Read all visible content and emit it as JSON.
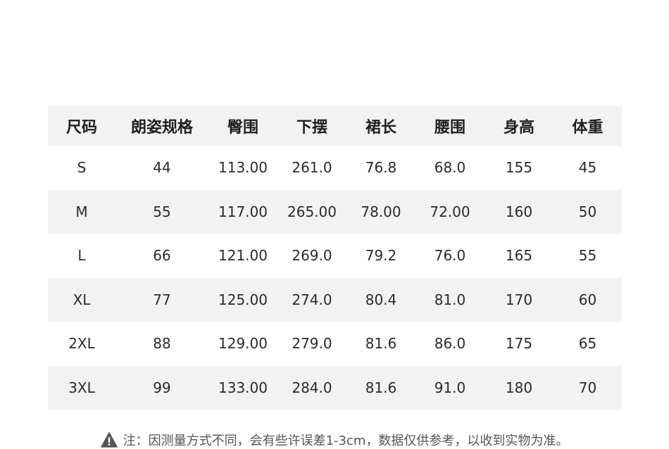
{
  "table": {
    "headers": [
      "尺码",
      "朗姿规格",
      "臀围",
      "下摆",
      "裙长",
      "腰围",
      "身高",
      "体重"
    ],
    "rows": [
      [
        "S",
        "44",
        "113.00",
        "261.0",
        "76.8",
        "68.0",
        "155",
        "45"
      ],
      [
        "M",
        "55",
        "117.00",
        "265.00",
        "78.00",
        "72.00",
        "160",
        "50"
      ],
      [
        "L",
        "66",
        "121.00",
        "269.0",
        "79.2",
        "76.0",
        "165",
        "55"
      ],
      [
        "XL",
        "77",
        "125.00",
        "274.0",
        "80.4",
        "81.0",
        "170",
        "60"
      ],
      [
        "2XL",
        "88",
        "129.00",
        "279.0",
        "81.6",
        "86.0",
        "175",
        "65"
      ],
      [
        "3XL",
        "99",
        "133.00",
        "284.0",
        "81.6",
        "91.0",
        "180",
        "70"
      ]
    ]
  },
  "note": {
    "icon": "warning-icon",
    "text": "注：因测量方式不同，会有些许误差1-3cm，数据仅供参考，以收到实物为准。"
  }
}
